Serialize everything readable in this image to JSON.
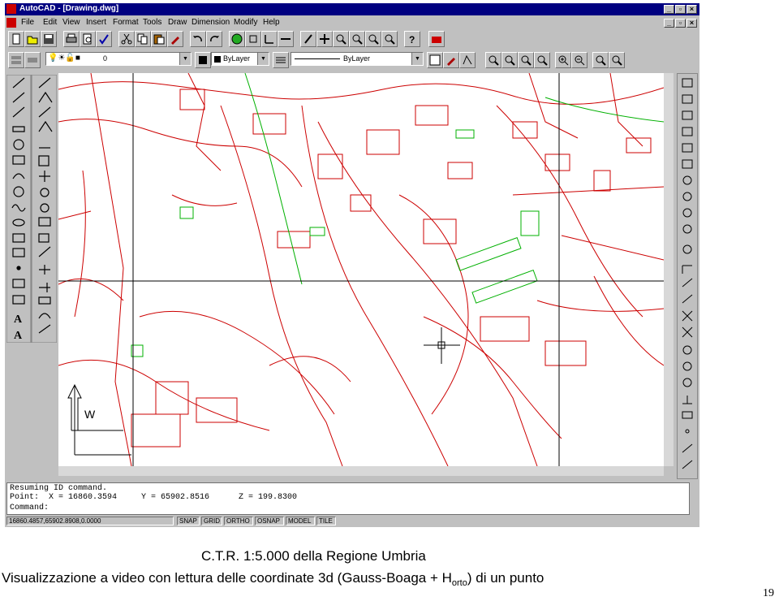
{
  "window": {
    "title": "AutoCAD - [Drawing.dwg]"
  },
  "menu": [
    "File",
    "Edit",
    "View",
    "Insert",
    "Format",
    "Tools",
    "Draw",
    "Dimension",
    "Modify",
    "Help"
  ],
  "layers": {
    "layer_name": "0",
    "color": "ByLayer",
    "linetype": "ByLayer"
  },
  "command_line": {
    "line1": "Resuming ID command.",
    "line2": "Point:  X = 16860.3594     Y = 65902.8516      Z = 199.8300",
    "line3": "Command:"
  },
  "status_bar": {
    "coords": "16860.4857,65902.8908,0.0000",
    "toggles": [
      "SNAP",
      "GRID",
      "ORTHO",
      "OSNAP",
      "MODEL",
      "TILE"
    ]
  },
  "caption": {
    "line1": "C.T.R. 1:5.000 della Regione Umbria",
    "line2_pre": "Visualizzazione a video con lettura delle coordinate 3d (Gauss-Boaga + H",
    "line2_sub": "orto",
    "line2_post": ") di un punto"
  },
  "page_number": "19",
  "colors": {
    "map_red": "#cc0000",
    "map_green": "#00b000",
    "title_blue": "#000080"
  }
}
